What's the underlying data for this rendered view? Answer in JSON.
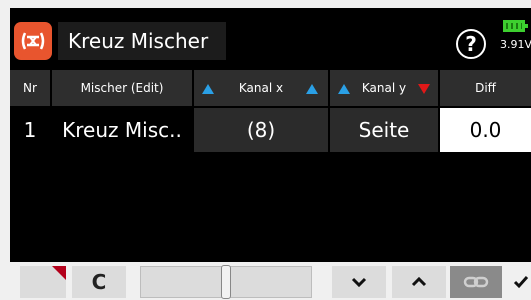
{
  "title": "Kreuz Mischer",
  "status": {
    "voltage": "3.91V",
    "help_symbol": "?"
  },
  "table": {
    "headers": {
      "nr": "Nr",
      "mischer": "Mischer (Edit)",
      "kanal_x": "Kanal x",
      "kanal_y": "Kanal y",
      "diff": "Diff"
    },
    "rows": [
      {
        "nr": "1",
        "mischer": "Kreuz Misc..",
        "kanal_x": "(8)",
        "kanal_y": "Seite",
        "diff": "0.0"
      }
    ]
  },
  "toolbar": {
    "reset_glyph": "C",
    "slider_value": 0.5
  },
  "colors": {
    "accent": "#e8552e",
    "header_bg": "#2e2e2e",
    "arrow_blue": "#2aa0e6",
    "arrow_red": "#e01818",
    "battery": "#3dcf2f"
  },
  "icons": [
    "mixer-app-icon",
    "help-icon",
    "battery-icon",
    "corner-flag-icon",
    "reset-icon",
    "chevron-down-icon",
    "chevron-up-icon",
    "link-icon",
    "checkmark-icon"
  ]
}
